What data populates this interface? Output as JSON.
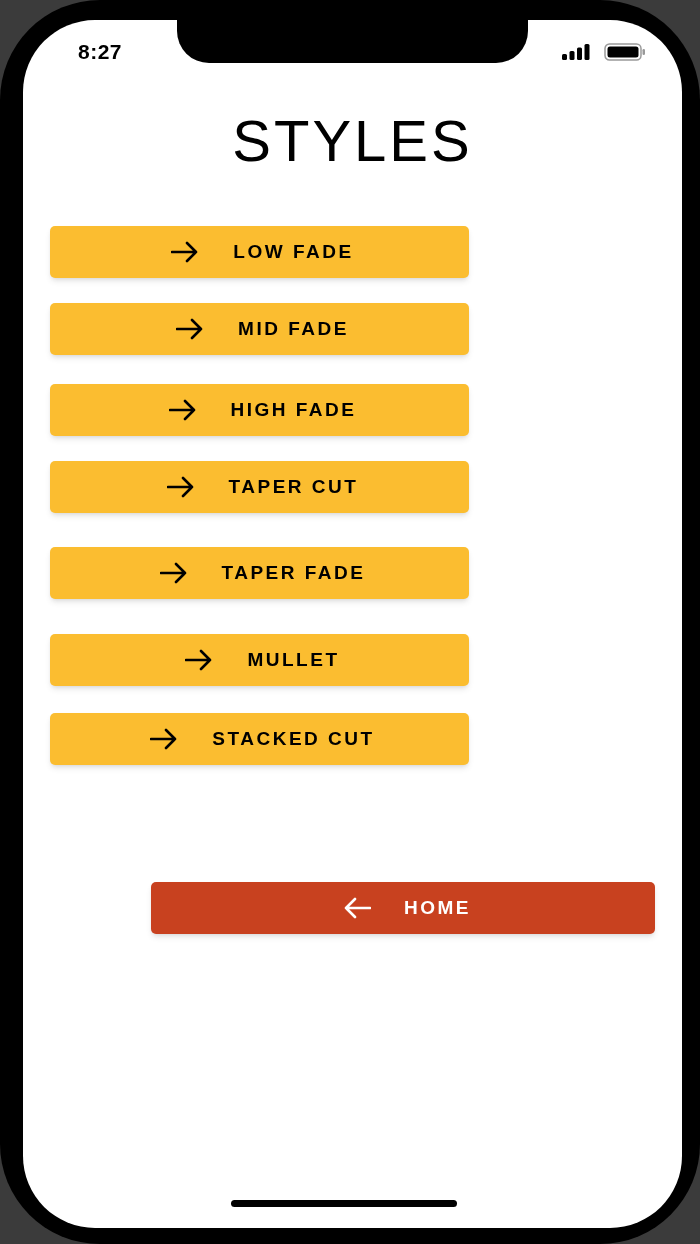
{
  "status_bar": {
    "time": "8:27"
  },
  "title": "STYLES",
  "style_buttons": [
    {
      "label": "LOW FADE"
    },
    {
      "label": "MID FADE"
    },
    {
      "label": "HIGH FADE"
    },
    {
      "label": "TAPER CUT"
    },
    {
      "label": "TAPER FADE"
    },
    {
      "label": "MULLET"
    },
    {
      "label": "STACKED CUT"
    }
  ],
  "home_button": {
    "label": "HOME"
  }
}
